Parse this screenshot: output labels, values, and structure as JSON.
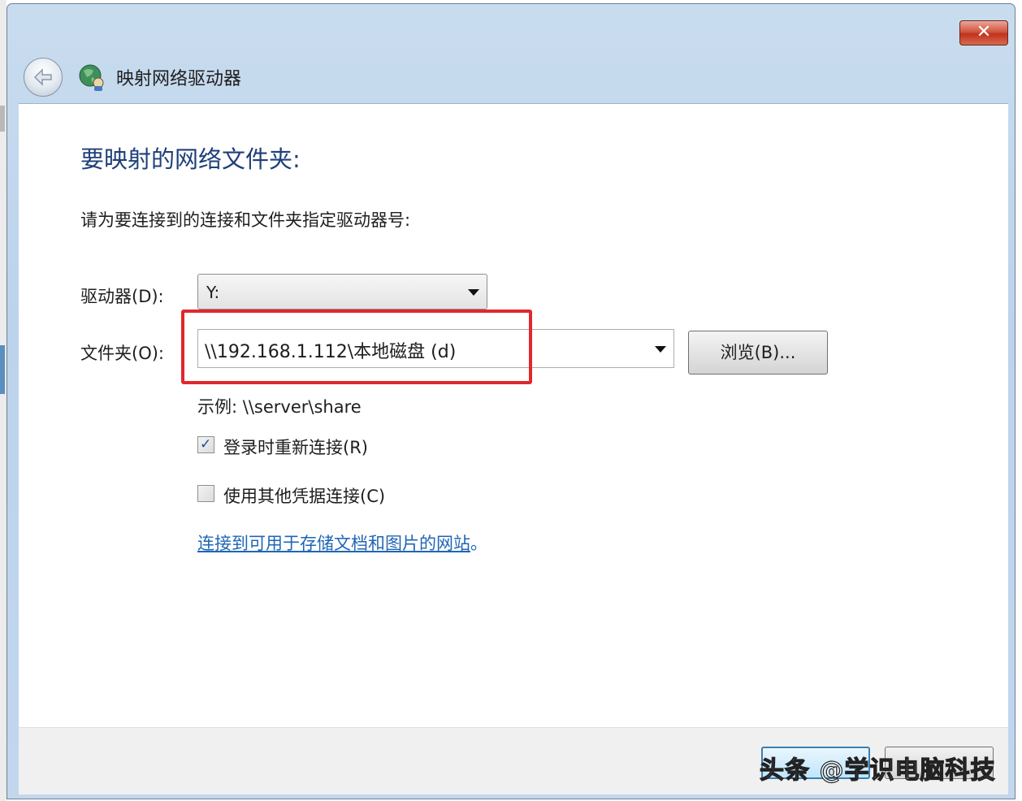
{
  "window": {
    "title": "映射网络驱动器",
    "close_label": "✕"
  },
  "main": {
    "heading": "要映射的网络文件夹:",
    "instruction": "请为要连接到的连接和文件夹指定驱动器号:",
    "drive_label": "驱动器(D):",
    "drive_value": "Y:",
    "folder_label": "文件夹(O):",
    "folder_value": "\\\\192.168.1.112\\本地磁盘 (d)",
    "browse_label": "浏览(B)...",
    "example": "示例: \\\\server\\share",
    "reconnect": {
      "label": "登录时重新连接(R)",
      "checked": true
    },
    "other_credentials": {
      "label": "使用其他凭据连接(C)",
      "checked": false
    },
    "link_text": "连接到可用于存储文档和图片的网站",
    "link_suffix": "。"
  },
  "watermark": "头条 @学识电脑科技",
  "colors": {
    "heading": "#1e3f7a",
    "link": "#1f66b5",
    "highlight": "#e0282d",
    "title_bar": "#bcd3ec"
  }
}
